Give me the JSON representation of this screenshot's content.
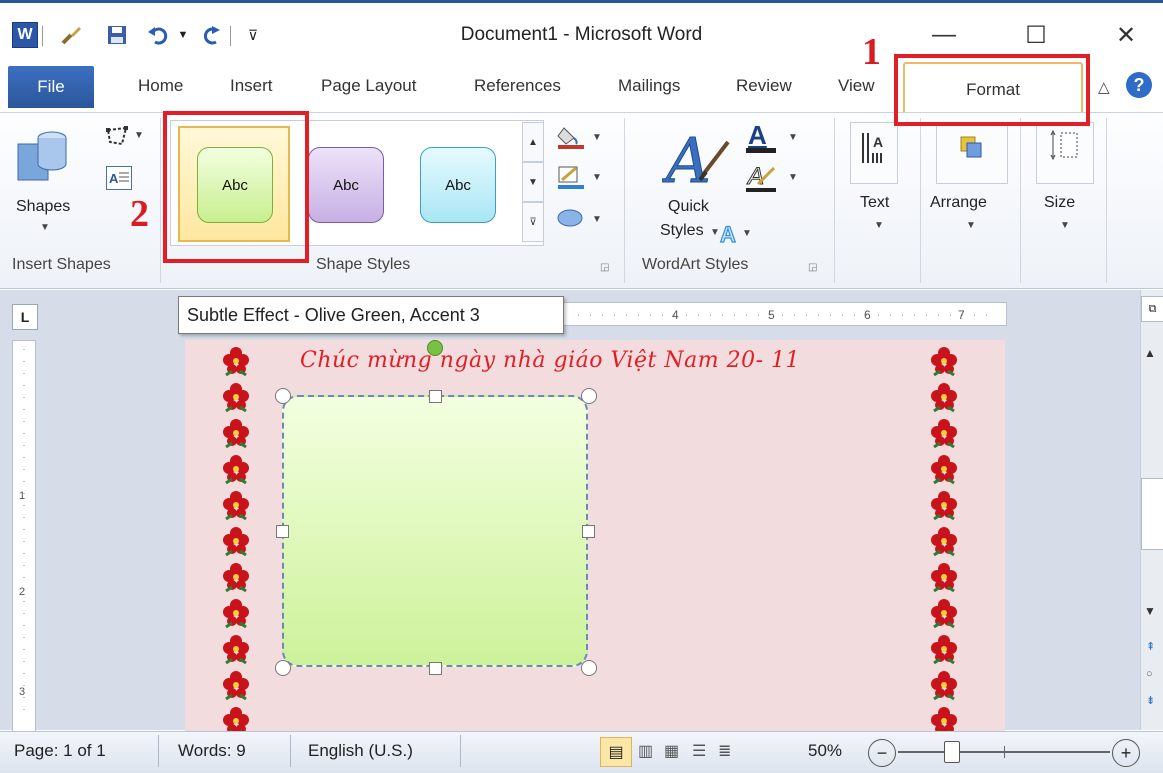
{
  "titlebar": {
    "title": "Document1  -  Microsoft Word",
    "app_icon_letter": "W",
    "qat": [
      "paintbrush-icon",
      "save-icon",
      "undo-icon",
      "dropdown-icon",
      "redo-icon",
      "customize-icon"
    ],
    "minimize": "—",
    "maximize": "☐",
    "close": "✕"
  },
  "tabs": {
    "file": "File",
    "home": "Home",
    "insert": "Insert",
    "page_layout": "Page Layout",
    "references": "References",
    "mailings": "Mailings",
    "review": "Review",
    "view": "View",
    "format": "Format",
    "collapse_glyph": "△",
    "help_glyph": "?"
  },
  "annotations": {
    "one": "1",
    "two": "2",
    "color": "#e21f26"
  },
  "ribbon": {
    "insert_shapes": {
      "shapes_label": "Shapes",
      "group_label": "Insert Shapes"
    },
    "shape_styles": {
      "group_label": "Shape Styles",
      "swatches": [
        {
          "label": "Abc",
          "color": "#d6f5a8",
          "selected": true
        },
        {
          "label": "Abc",
          "color": "#cfb9e6",
          "selected": false
        },
        {
          "label": "Abc",
          "color": "#b5ecf7",
          "selected": false
        }
      ]
    },
    "wordart_styles": {
      "quick_styles_line1": "Quick",
      "quick_styles_line2": "Styles",
      "group_label": "WordArt Styles"
    },
    "text": {
      "label": "Text"
    },
    "arrange": {
      "label": "Arrange"
    },
    "size": {
      "label": "Size"
    }
  },
  "tooltip": "Subtle Effect - Olive Green, Accent 3",
  "document": {
    "greeting": "Chúc mừng ngày nhà giáo Việt Nam 20- 11",
    "ruler_corner": "L"
  },
  "statusbar": {
    "page": "Page: 1 of 1",
    "words": "Words: 9",
    "language": "English (U.S.)",
    "zoom": "50%",
    "zoom_minus": "−",
    "zoom_plus": "+"
  }
}
